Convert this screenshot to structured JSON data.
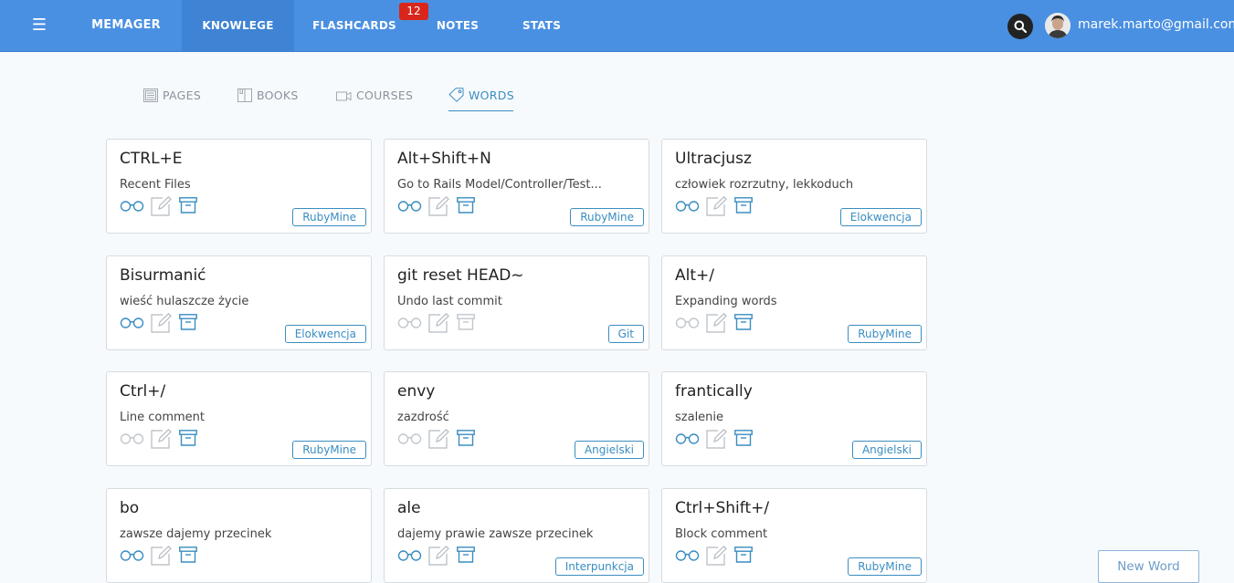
{
  "nav": {
    "menu_icon": "hamburger-icon",
    "brand": "MEMAGER",
    "items": [
      "KNOWLEGE",
      "FLASHCARDS",
      "NOTES",
      "STATS"
    ],
    "flashcards_badge": "12",
    "user_email": "marek.marto@gmail.com"
  },
  "subtabs": {
    "pages": "PAGES",
    "books": "BOOKS",
    "courses": "COURSES",
    "words": "WORDS"
  },
  "colors": {
    "topbar": "#4a90e2",
    "accent": "#3a8dc1",
    "badge": "#d9261c"
  },
  "cards": [
    {
      "title": "CTRL+E",
      "desc": "Recent Files",
      "tag": "RubyMine",
      "glasses_active": true,
      "archive_active": true
    },
    {
      "title": "Alt+Shift+N",
      "desc": "Go to Rails Model/Controller/Test...",
      "tag": "RubyMine",
      "glasses_active": true,
      "archive_active": true
    },
    {
      "title": "Ultracjusz",
      "desc": "człowiek rozrzutny, lekkoduch",
      "tag": "Elokwencja",
      "glasses_active": true,
      "archive_active": true
    },
    {
      "title": "Bisurmanić",
      "desc": "wieść hulaszcze życie",
      "tag": "Elokwencja",
      "glasses_active": true,
      "archive_active": true
    },
    {
      "title": "git reset HEAD~",
      "desc": "Undo last commit",
      "tag": "Git",
      "glasses_active": false,
      "archive_active": false
    },
    {
      "title": "Alt+/",
      "desc": "Expanding words",
      "tag": "RubyMine",
      "glasses_active": false,
      "archive_active": true
    },
    {
      "title": "Ctrl+/",
      "desc": "Line comment",
      "tag": "RubyMine",
      "glasses_active": false,
      "archive_active": true
    },
    {
      "title": "envy",
      "desc": "zazdrość",
      "tag": "Angielski",
      "glasses_active": false,
      "archive_active": true
    },
    {
      "title": "frantically",
      "desc": "szalenie",
      "tag": "Angielski",
      "glasses_active": true,
      "archive_active": true
    },
    {
      "title": "bo",
      "desc": "zawsze dajemy przecinek",
      "tag": "",
      "glasses_active": true,
      "archive_active": true
    },
    {
      "title": "ale",
      "desc": "dajemy prawie zawsze przecinek",
      "tag": "Interpunkcja",
      "glasses_active": true,
      "archive_active": true
    },
    {
      "title": "Ctrl+Shift+/",
      "desc": "Block comment",
      "tag": "RubyMine",
      "glasses_active": true,
      "archive_active": true
    }
  ],
  "new_word_label": "New Word"
}
